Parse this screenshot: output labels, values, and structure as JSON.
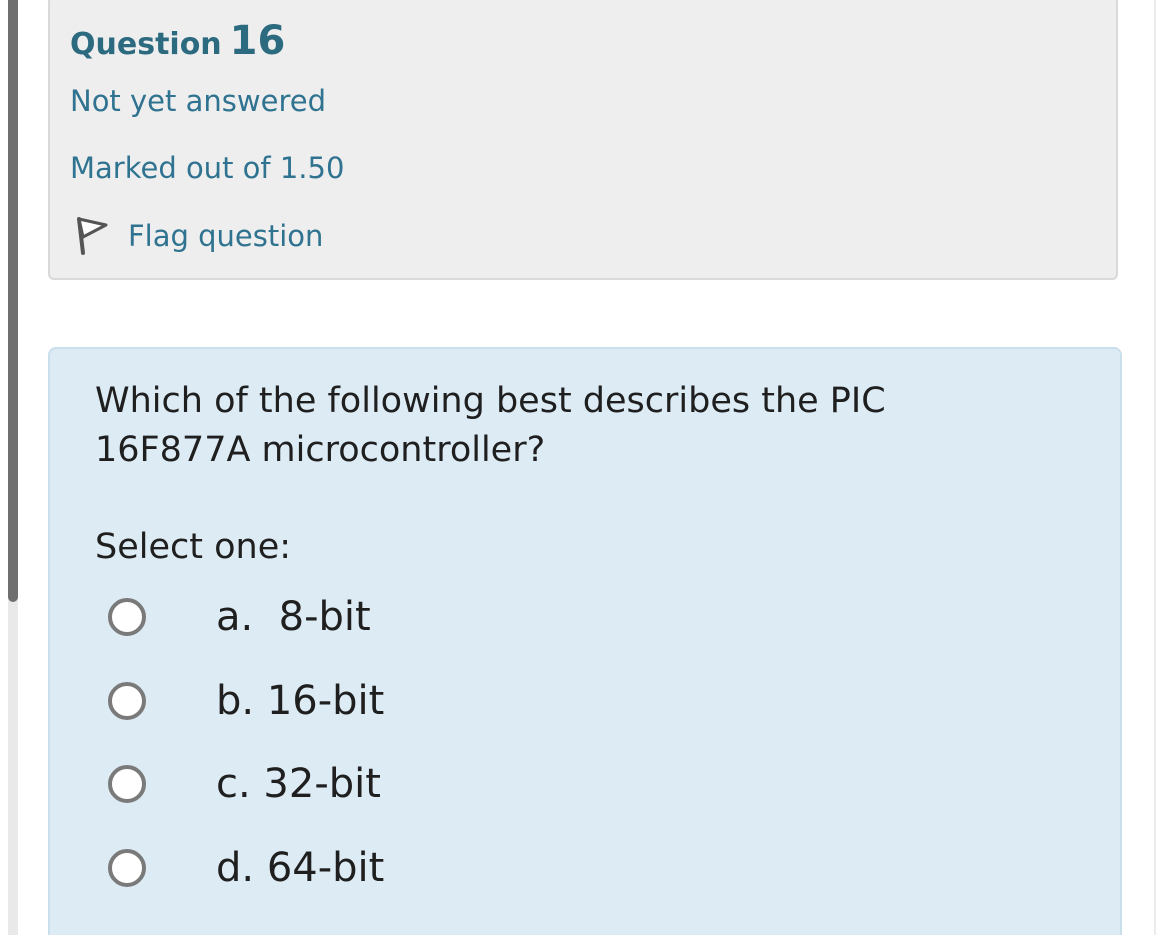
{
  "info": {
    "question_word": "Question",
    "question_number": "16",
    "state": "Not yet answered",
    "grade": "Marked out of 1.50",
    "flag_label": "Flag question",
    "flag_icon": "flag-outline-icon"
  },
  "content": {
    "question_text": "Which of the following best describes the PIC 16F877A microcontroller?",
    "prompt": "Select one:",
    "options": [
      {
        "label": "a.  8-bit",
        "selected": false
      },
      {
        "label": "b. 16-bit",
        "selected": false
      },
      {
        "label": "c. 32-bit",
        "selected": false
      },
      {
        "label": "d. 64-bit",
        "selected": false
      }
    ]
  },
  "colors": {
    "link_teal": "#2f7390",
    "info_bg": "#eeeeee",
    "content_bg": "#dcebf4"
  }
}
